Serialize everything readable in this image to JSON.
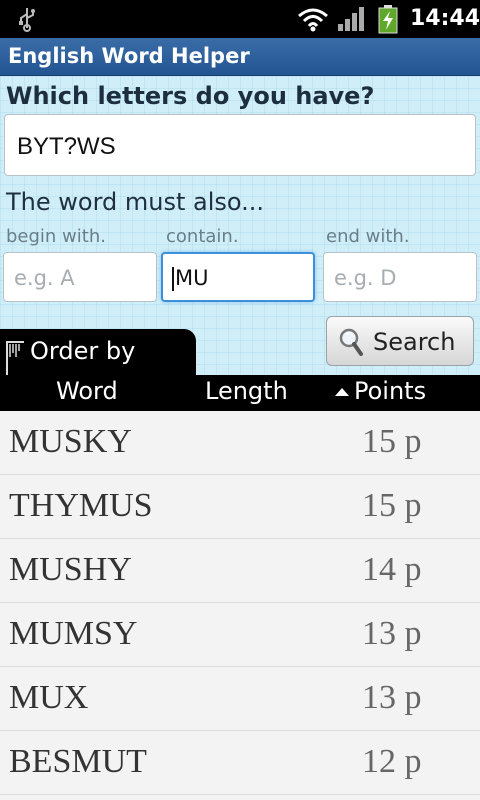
{
  "status_bar": {
    "time": "14:44",
    "icons": [
      "usb-icon",
      "wifi-icon",
      "signal-icon",
      "battery-charging-icon"
    ]
  },
  "app": {
    "title": "English Word Helper"
  },
  "form": {
    "question": "Which letters do you have?",
    "letters_value": "BYT?WS",
    "must_also": "The word must also...",
    "begin_label": "begin with.",
    "begin_placeholder": "e.g. A",
    "contain_label": "contain.",
    "contain_value": "MU",
    "end_label": "end with.",
    "end_placeholder": "e.g. D",
    "search_label": "Search"
  },
  "sort": {
    "order_by_label": "Order by",
    "columns": [
      "Word",
      "Length",
      "Points"
    ],
    "active_column": "Points",
    "direction": "descending"
  },
  "results": [
    {
      "word": "MUSKY",
      "points": "15 p"
    },
    {
      "word": "THYMUS",
      "points": "15 p"
    },
    {
      "word": "MUSHY",
      "points": "14 p"
    },
    {
      "word": "MUMSY",
      "points": "13 p"
    },
    {
      "word": "MUX",
      "points": "13 p"
    },
    {
      "word": "BESMUT",
      "points": "12 p"
    }
  ],
  "colors": {
    "title_bar": "#225591",
    "panel_bg": "#cfeef8",
    "focus": "#3d8fd8",
    "list_bg": "#f3f3f3"
  }
}
